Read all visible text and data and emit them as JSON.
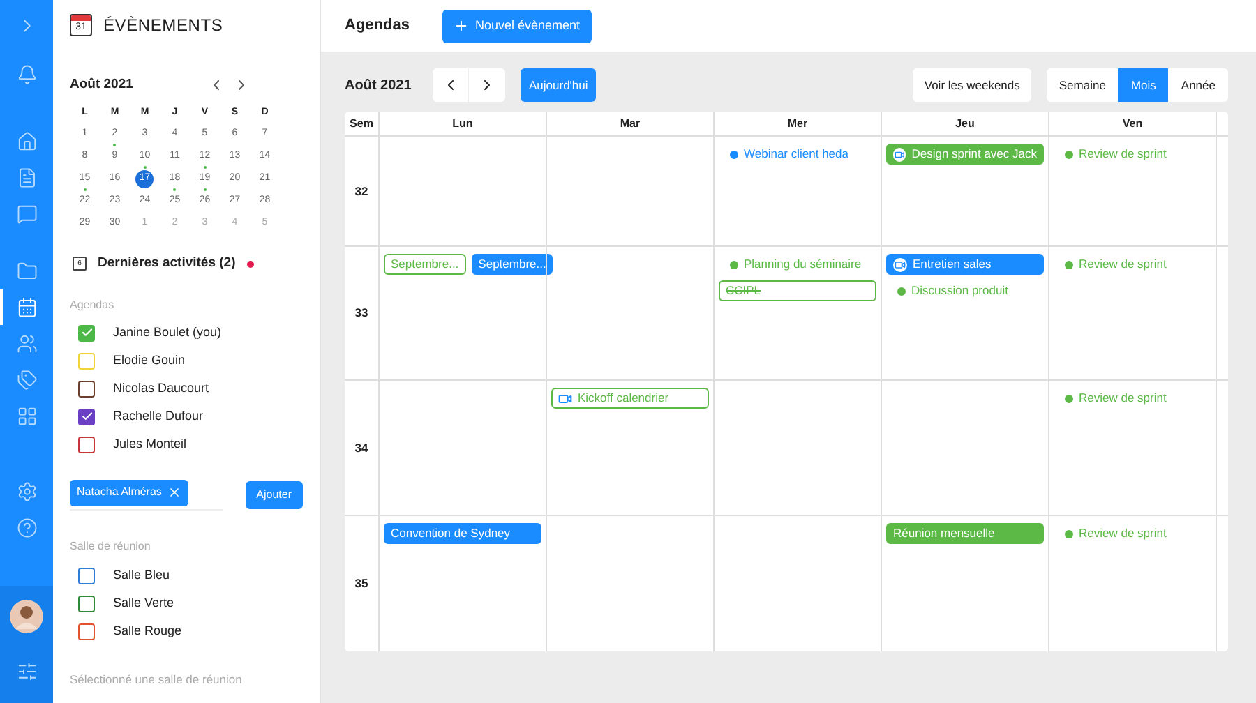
{
  "rail": {
    "top": [
      {
        "kind": "expand",
        "selected": false
      }
    ],
    "items": [
      {
        "kind": "bell",
        "selected": false
      },
      {
        "kind": "home",
        "selected": false
      },
      {
        "kind": "document",
        "selected": false
      },
      {
        "kind": "chat",
        "selected": false
      },
      {
        "kind": "folder",
        "selected": false
      },
      {
        "kind": "calendar",
        "selected": true
      },
      {
        "kind": "users",
        "selected": false
      },
      {
        "kind": "tags",
        "selected": false
      },
      {
        "kind": "grid",
        "selected": false
      },
      {
        "kind": "settings",
        "selected": false
      },
      {
        "kind": "help",
        "selected": false
      }
    ],
    "bottom": [
      {
        "kind": "avatar",
        "selected": false
      },
      {
        "kind": "sliders",
        "selected": false
      }
    ]
  },
  "sidebar": {
    "title": "ÉVÈNEMENTS",
    "calendar_badge": "31",
    "mini_calendar": {
      "title": "Août 2021",
      "weekdays": [
        "L",
        "M",
        "M",
        "J",
        "V",
        "S",
        "D"
      ],
      "weeks": [
        [
          {
            "day": "1",
            "selected": false,
            "event": false,
            "other_month": false
          },
          {
            "day": "2",
            "selected": false,
            "event": true,
            "other_month": false
          },
          {
            "day": "3",
            "selected": false,
            "event": false,
            "other_month": false
          },
          {
            "day": "4",
            "selected": false,
            "event": false,
            "other_month": false
          },
          {
            "day": "5",
            "selected": false,
            "event": false,
            "other_month": false
          },
          {
            "day": "6",
            "selected": false,
            "event": false,
            "other_month": false
          },
          {
            "day": "7",
            "selected": false,
            "event": false,
            "other_month": false
          }
        ],
        [
          {
            "day": "8",
            "selected": false,
            "event": false,
            "other_month": false
          },
          {
            "day": "9",
            "selected": false,
            "event": false,
            "other_month": false
          },
          {
            "day": "10",
            "selected": false,
            "event": true,
            "other_month": false
          },
          {
            "day": "11",
            "selected": false,
            "event": false,
            "other_month": false
          },
          {
            "day": "12",
            "selected": false,
            "event": true,
            "other_month": false
          },
          {
            "day": "13",
            "selected": false,
            "event": false,
            "other_month": false
          },
          {
            "day": "14",
            "selected": false,
            "event": false,
            "other_month": false
          }
        ],
        [
          {
            "day": "15",
            "selected": false,
            "event": true,
            "other_month": false
          },
          {
            "day": "16",
            "selected": false,
            "event": false,
            "other_month": false
          },
          {
            "day": "17",
            "selected": true,
            "event": false,
            "other_month": false
          },
          {
            "day": "18",
            "selected": false,
            "event": true,
            "other_month": false
          },
          {
            "day": "19",
            "selected": false,
            "event": true,
            "other_month": false
          },
          {
            "day": "20",
            "selected": false,
            "event": false,
            "other_month": false
          },
          {
            "day": "21",
            "selected": false,
            "event": false,
            "other_month": false
          }
        ],
        [
          {
            "day": "22",
            "selected": false,
            "event": false,
            "other_month": false
          },
          {
            "day": "23",
            "selected": false,
            "event": false,
            "other_month": false
          },
          {
            "day": "24",
            "selected": false,
            "event": false,
            "other_month": false
          },
          {
            "day": "25",
            "selected": false,
            "event": false,
            "other_month": false
          },
          {
            "day": "26",
            "selected": false,
            "event": false,
            "other_month": false
          },
          {
            "day": "27",
            "selected": false,
            "event": false,
            "other_month": false
          },
          {
            "day": "28",
            "selected": false,
            "event": false,
            "other_month": false
          }
        ],
        [
          {
            "day": "29",
            "selected": false,
            "event": false,
            "other_month": false
          },
          {
            "day": "30",
            "selected": false,
            "event": false,
            "other_month": false
          },
          {
            "day": "1",
            "selected": false,
            "event": false,
            "other_month": true
          },
          {
            "day": "2",
            "selected": false,
            "event": false,
            "other_month": true
          },
          {
            "day": "3",
            "selected": false,
            "event": false,
            "other_month": true
          },
          {
            "day": "4",
            "selected": false,
            "event": false,
            "other_month": true
          },
          {
            "day": "5",
            "selected": false,
            "event": false,
            "other_month": true
          }
        ]
      ]
    },
    "recent": {
      "label": "Dernières activités (2)",
      "icon_badge": "6",
      "unread": true
    },
    "agendas_label": "Agendas",
    "agendas": [
      {
        "name": "Janine Boulet (you)",
        "checked": true,
        "color": "#4cb848"
      },
      {
        "name": "Elodie Gouin",
        "checked": false,
        "color": "#f2d33a"
      },
      {
        "name": "Nicolas Daucourt",
        "checked": false,
        "color": "#6b3e2e"
      },
      {
        "name": "Rachelle Dufour",
        "checked": true,
        "color": "#6a3fc4"
      },
      {
        "name": "Jules Monteil",
        "checked": false,
        "color": "#c8343b"
      }
    ],
    "chip": "Natacha Alméras",
    "add_button": "Ajouter",
    "rooms_label": "Salle de réunion",
    "rooms": [
      {
        "name": "Salle Bleu",
        "checked": false,
        "color": "#2e7dd6"
      },
      {
        "name": "Salle Verte",
        "checked": false,
        "color": "#2f8a3a"
      },
      {
        "name": "Salle Rouge",
        "checked": false,
        "color": "#e2522f"
      }
    ],
    "rooms_hint": "Sélectionné une salle de réunion"
  },
  "header": {
    "title": "Agendas",
    "new_button": "Nouvel évènement"
  },
  "toolbar": {
    "month": "Août 2021",
    "today": "Aujourd'hui",
    "weekends": "Voir les weekends",
    "views": [
      {
        "label": "Semaine",
        "selected": false
      },
      {
        "label": "Mois",
        "selected": true
      },
      {
        "label": "Année",
        "selected": false
      }
    ]
  },
  "grid": {
    "week_header": "Sem",
    "days": [
      "Lun",
      "Mar",
      "Mer",
      "Jeu",
      "Ven"
    ],
    "weeks": [
      {
        "week": "32",
        "cells": [
          {},
          {},
          {
            "events": [
              {
                "kind": "dot",
                "title": "Webinar client heda",
                "color": "#1a8cff"
              }
            ]
          },
          {
            "events": [
              {
                "kind": "bar-icon",
                "title": "Design sprint avec Jack",
                "color": "#5cb946"
              }
            ]
          },
          {
            "events": [
              {
                "kind": "dot",
                "title": "Review de sprint",
                "color": "#5cb946"
              }
            ]
          }
        ]
      },
      {
        "week": "33",
        "cells": [
          {
            "side_by_side": true,
            "events": [
              {
                "kind": "outline",
                "title": "Septembre...",
                "color": "#5cb946"
              },
              {
                "kind": "bar",
                "title": "Septembre...",
                "color": "#1a8cff"
              }
            ]
          },
          {},
          {
            "events": [
              {
                "kind": "dot",
                "title": "Planning du séminaire",
                "color": "#5cb946"
              },
              {
                "kind": "outline-struck",
                "title": "CCIPL",
                "color": "#5cb946"
              }
            ]
          },
          {
            "events": [
              {
                "kind": "bar-icon",
                "title": "Entretien sales",
                "color": "#1a8cff"
              },
              {
                "kind": "dot",
                "title": "Discussion produit",
                "color": "#5cb946"
              }
            ]
          },
          {
            "events": [
              {
                "kind": "dot",
                "title": "Review de sprint",
                "color": "#5cb946"
              }
            ]
          }
        ]
      },
      {
        "week": "34",
        "cells": [
          {},
          {
            "events": [
              {
                "kind": "outline-icon",
                "title": "Kickoff calendrier",
                "color": "#5cb946"
              }
            ]
          },
          {},
          {},
          {
            "events": [
              {
                "kind": "dot",
                "title": "Review de sprint",
                "color": "#5cb946"
              }
            ]
          }
        ]
      },
      {
        "week": "35",
        "cells": [
          {
            "events": [
              {
                "kind": "bar",
                "title": "Convention de Sydney",
                "color": "#1a8cff"
              }
            ]
          },
          {},
          {},
          {
            "events": [
              {
                "kind": "bar",
                "title": "Réunion mensuelle",
                "color": "#5cb946"
              }
            ]
          },
          {
            "events": [
              {
                "kind": "dot",
                "title": "Review de sprint",
                "color": "#5cb946"
              }
            ]
          }
        ]
      }
    ]
  }
}
